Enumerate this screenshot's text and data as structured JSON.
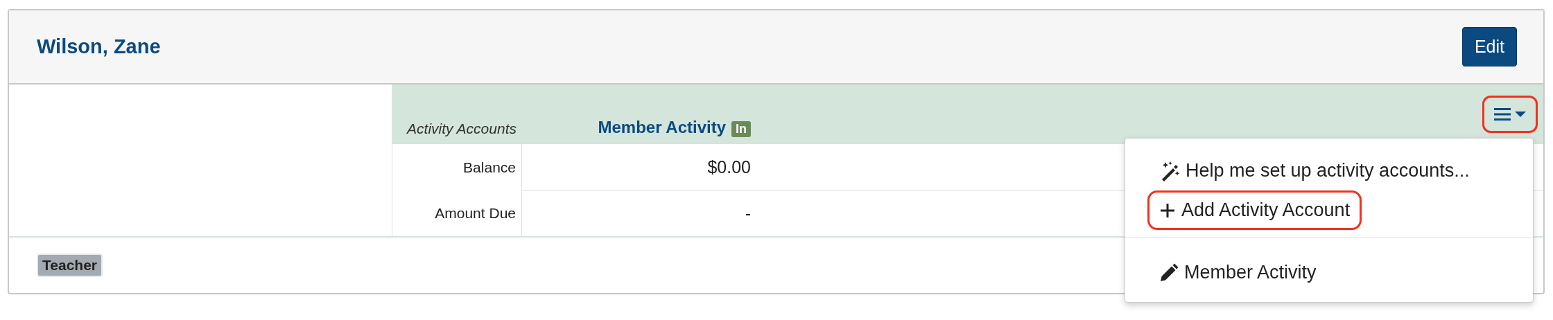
{
  "header": {
    "title": "Wilson, Zane",
    "edit_button": "Edit"
  },
  "accounts_table": {
    "label_heading": "Activity Accounts",
    "columns": [
      {
        "name": "Member Activity",
        "badge": "In"
      }
    ],
    "rows": [
      {
        "label": "Balance",
        "values": [
          "$0.00"
        ]
      },
      {
        "label": "Amount Due",
        "values": [
          "-"
        ]
      }
    ],
    "menu_button": {
      "highlighted": true
    }
  },
  "menu": {
    "sections": [
      [
        {
          "label": "Help me set up activity accounts...",
          "highlighted": false
        },
        {
          "label": "Add Activity Account",
          "highlighted": true
        }
      ],
      [
        {
          "label": "Member Activity",
          "highlighted": false
        }
      ]
    ]
  },
  "tags": [
    "Teacher"
  ]
}
